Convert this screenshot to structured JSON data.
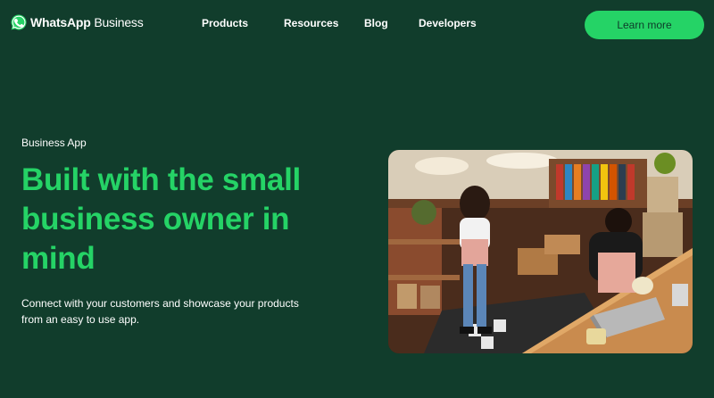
{
  "brand": {
    "name_strong": "WhatsApp",
    "name_light": "Business",
    "logo_icon": "whatsapp-logo-icon",
    "accent_color": "#25d366",
    "background_color": "#113d2c"
  },
  "nav": {
    "items": [
      {
        "label": "Products"
      },
      {
        "label": "Resources"
      },
      {
        "label": "Blog"
      },
      {
        "label": "Developers"
      }
    ],
    "cta_label": "Learn more"
  },
  "hero": {
    "eyebrow": "Business App",
    "headline": "Built with the small business owner in mind",
    "description": "Connect with your customers and showcase your products from an easy to use app.",
    "image_subject": "hero-photo"
  }
}
